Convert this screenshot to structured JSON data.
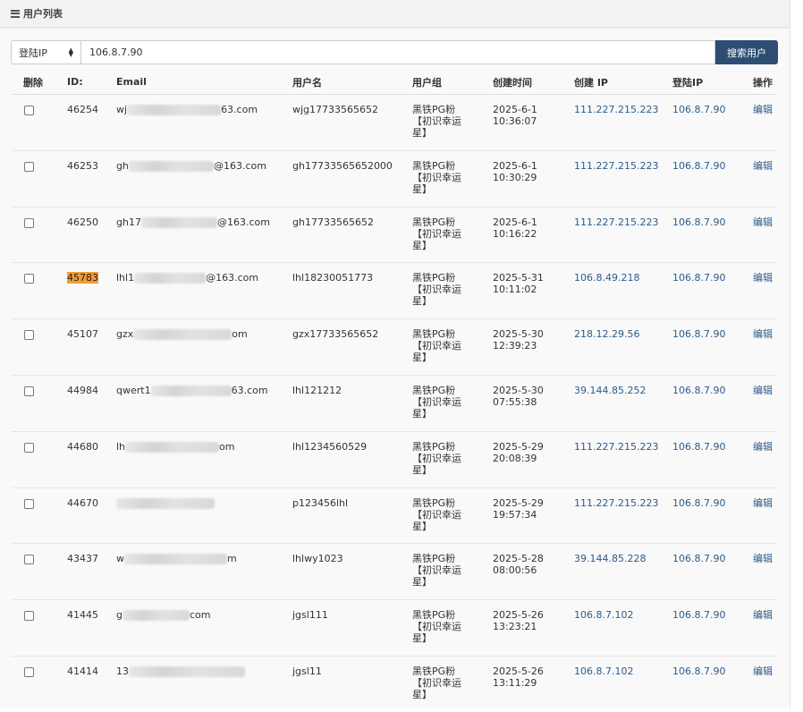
{
  "header": {
    "title": "用户列表"
  },
  "search": {
    "select_value": "登陆IP",
    "input_value": "106.8.7.90",
    "button_label": "搜索用户"
  },
  "table": {
    "headers": [
      "删除",
      "ID:",
      "Email",
      "用户名",
      "用户组",
      "创建时间",
      "创建 IP",
      "登陆IP",
      "操作"
    ],
    "rows": [
      {
        "id": "46254",
        "email_pre": "wj",
        "email_post": "63.com",
        "username": "wjg17733565652",
        "group": "黑铁PG粉\n【初识幸运\n星】",
        "time": "2025-6-1\n10:36:07",
        "create_ip": "111.227.215.223",
        "login_ip": "106.8.7.90",
        "action": "编辑"
      },
      {
        "id": "46253",
        "email_pre": "gh",
        "email_post": "@163.com",
        "username": "gh17733565652000",
        "group": "黑铁PG粉\n【初识幸运\n星】",
        "time": "2025-6-1\n10:30:29",
        "create_ip": "111.227.215.223",
        "login_ip": "106.8.7.90",
        "action": "编辑"
      },
      {
        "id": "46250",
        "email_pre": "gh17",
        "email_post": "@163.com",
        "username": "gh17733565652",
        "group": "黑铁PG粉\n【初识幸运\n星】",
        "time": "2025-6-1\n10:16:22",
        "create_ip": "111.227.215.223",
        "login_ip": "106.8.7.90",
        "action": "编辑"
      },
      {
        "id": "45783",
        "email_pre": "lhl1",
        "email_post": "@163.com",
        "username": "lhl18230051773",
        "group": "黑铁PG粉\n【初识幸运\n星】",
        "time": "2025-5-31\n10:11:02",
        "create_ip": "106.8.49.218",
        "login_ip": "106.8.7.90",
        "action": "编辑",
        "highlight": true
      },
      {
        "id": "45107",
        "email_pre": "gzx",
        "email_post": "om",
        "username": "gzx17733565652",
        "group": "黑铁PG粉\n【初识幸运\n星】",
        "time": "2025-5-30\n12:39:23",
        "create_ip": "218.12.29.56",
        "login_ip": "106.8.7.90",
        "action": "编辑"
      },
      {
        "id": "44984",
        "email_pre": "qwert1",
        "email_post": "63.com",
        "username": "lhl121212",
        "group": "黑铁PG粉\n【初识幸运\n星】",
        "time": "2025-5-30\n07:55:38",
        "create_ip": "39.144.85.252",
        "login_ip": "106.8.7.90",
        "action": "编辑"
      },
      {
        "id": "44680",
        "email_pre": "lh",
        "email_post": "om",
        "username": "lhl1234560529",
        "group": "黑铁PG粉\n【初识幸运\n星】",
        "time": "2025-5-29\n20:08:39",
        "create_ip": "111.227.215.223",
        "login_ip": "106.8.7.90",
        "action": "编辑"
      },
      {
        "id": "44670",
        "email_pre": "",
        "email_post": "",
        "username": "p123456lhl",
        "group": "黑铁PG粉\n【初识幸运\n星】",
        "time": "2025-5-29\n19:57:34",
        "create_ip": "111.227.215.223",
        "login_ip": "106.8.7.90",
        "action": "编辑"
      },
      {
        "id": "43437",
        "email_pre": "w",
        "email_post": "m",
        "username": "lhlwy1023",
        "group": "黑铁PG粉\n【初识幸运\n星】",
        "time": "2025-5-28\n08:00:56",
        "create_ip": "39.144.85.228",
        "login_ip": "106.8.7.90",
        "action": "编辑"
      },
      {
        "id": "41445",
        "email_pre": "g",
        "email_post": "com",
        "username": "jgsl111",
        "group": "黑铁PG粉\n【初识幸运\n星】",
        "time": "2025-5-26\n13:23:21",
        "create_ip": "106.8.7.102",
        "login_ip": "106.8.7.90",
        "action": "编辑"
      },
      {
        "id": "41414",
        "email_pre": "13",
        "email_post": "",
        "username": "jgsl11",
        "group": "黑铁PG粉\n【初识幸运\n星】",
        "time": "2025-5-26\n13:11:29",
        "create_ip": "106.8.7.102",
        "login_ip": "106.8.7.90",
        "action": "编辑"
      }
    ]
  },
  "colors": {
    "primary_button": "#2d4e72",
    "link": "#2d5a8a",
    "highlight": "#f39c34"
  }
}
